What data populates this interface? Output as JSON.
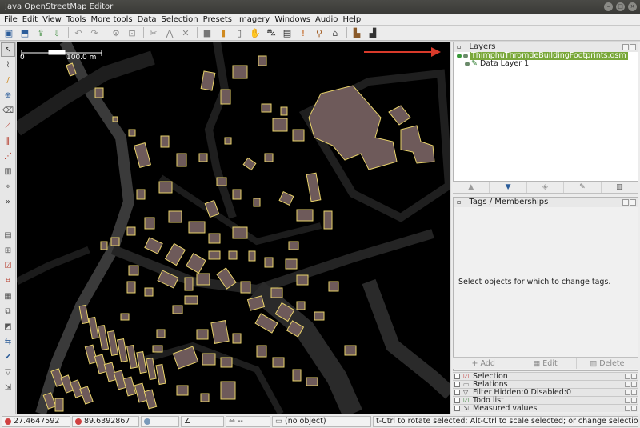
{
  "window": {
    "title": "Java OpenStreetMap Editor"
  },
  "menu": [
    "File",
    "Edit",
    "View",
    "Tools",
    "More tools",
    "Data",
    "Selection",
    "Presets",
    "Imagery",
    "Windows",
    "Audio",
    "Help"
  ],
  "map": {
    "scale_zero": "0",
    "scale_label": "100.0 m"
  },
  "layers": {
    "title": "Layers",
    "items": [
      {
        "name": "ThimphuThromdeBuildingFootprints.osm",
        "active": true
      },
      {
        "name": "Data Layer 1",
        "active": false
      }
    ]
  },
  "tags": {
    "title": "Tags / Memberships",
    "empty_message": "Select objects for which to change tags.",
    "add_label": "Add",
    "edit_label": "Edit",
    "delete_label": "Delete"
  },
  "panels": [
    {
      "label": "Selection"
    },
    {
      "label": "Relations"
    },
    {
      "label": "Filter Hidden:0 Disabled:0"
    },
    {
      "label": "Todo list"
    },
    {
      "label": "Measured values"
    }
  ],
  "status": {
    "lat": "27.4647592",
    "lon": "89.6392867",
    "heading_placeholder": "--",
    "selection": "(no object)",
    "help_text": "t-Ctrl to rotate selected; Alt-Ctrl to scale selected; or change selection"
  },
  "colors": {
    "map_bg": "#000000",
    "building_fill": "#6e5a5a",
    "building_stroke": "#e8d26a",
    "road": "#3d3d3d",
    "active_layer": "#7aa83a",
    "arrow": "#d93a2a"
  }
}
